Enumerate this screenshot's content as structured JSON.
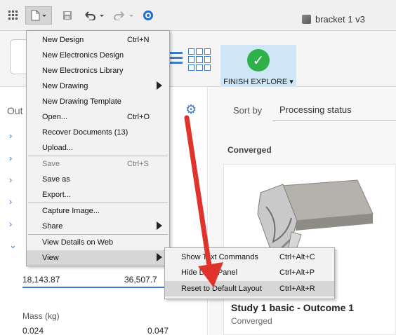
{
  "document_title": "bracket 1 v3",
  "ribbon": {
    "finish_label": "FINISH EXPLORE ▾"
  },
  "left_panel": {
    "title": "Out",
    "range_min": "18,143.87",
    "range_max": "36,507.7",
    "mass_label": "Mass (kg)",
    "mass_min": "0.024",
    "mass_max": "0.047"
  },
  "right_panel": {
    "sort_label": "Sort by",
    "sort_value": "Processing status",
    "group_header": "Converged",
    "card_title": "Study 1 basic - Outcome 1",
    "card_status": "Converged"
  },
  "file_menu": {
    "items": [
      {
        "label": "New Design",
        "shortcut": "Ctrl+N"
      },
      {
        "label": "New Electronics Design",
        "shortcut": ""
      },
      {
        "label": "New Electronics Library",
        "shortcut": ""
      },
      {
        "label": "New Drawing",
        "shortcut": ""
      },
      {
        "label": "New Drawing Template",
        "shortcut": ""
      },
      {
        "label": "Open...",
        "shortcut": "Ctrl+O"
      },
      {
        "label": "Recover Documents (13)",
        "shortcut": ""
      },
      {
        "label": "Upload...",
        "shortcut": ""
      },
      {
        "label": "Save",
        "shortcut": "Ctrl+S"
      },
      {
        "label": "Save as",
        "shortcut": ""
      },
      {
        "label": "Export...",
        "shortcut": ""
      },
      {
        "label": "Capture Image...",
        "shortcut": ""
      },
      {
        "label": "Share",
        "shortcut": ""
      },
      {
        "label": "View Details on Web",
        "shortcut": ""
      },
      {
        "label": "View",
        "shortcut": ""
      }
    ]
  },
  "view_submenu": {
    "items": [
      {
        "label": "Show Text Commands",
        "shortcut": "Ctrl+Alt+C"
      },
      {
        "label": "Hide Data Panel",
        "shortcut": "Ctrl+Alt+P"
      },
      {
        "label": "Reset to Default Layout",
        "shortcut": "Ctrl+Alt+R"
      }
    ]
  },
  "colors": {
    "accent": "#3a7cc9",
    "finish_bg": "#cfe6f7",
    "check_green": "#2fb14a",
    "annotation_red": "#e0332b"
  }
}
